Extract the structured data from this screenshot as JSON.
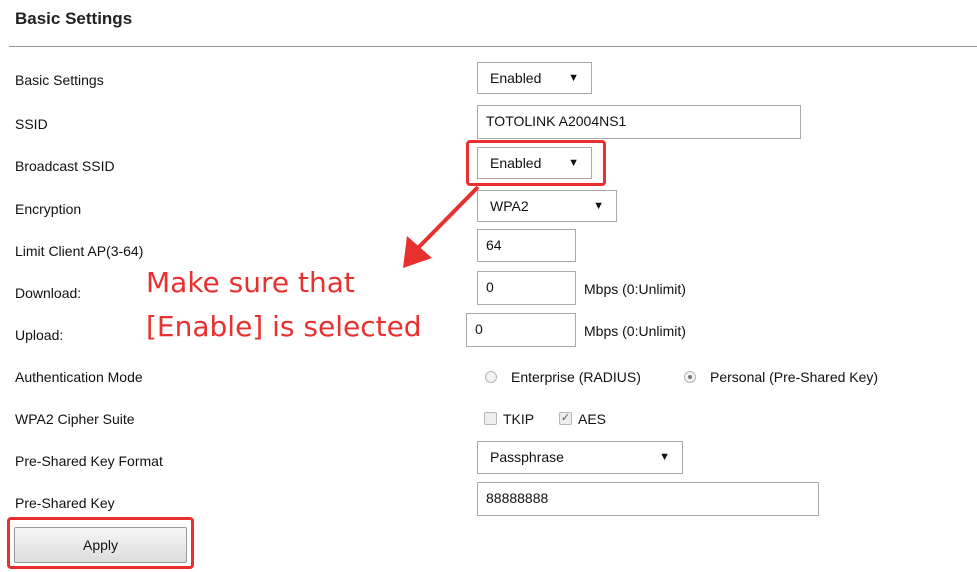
{
  "page": {
    "title": "Basic Settings"
  },
  "rows": {
    "basic_settings": {
      "label": "Basic Settings",
      "value": "Enabled"
    },
    "ssid": {
      "label": "SSID",
      "value": "TOTOLINK A2004NS1"
    },
    "broadcast_ssid": {
      "label": "Broadcast SSID",
      "value": "Enabled"
    },
    "encryption": {
      "label": "Encryption",
      "value": "WPA2"
    },
    "limit_client": {
      "label": "Limit Client AP(3-64)",
      "value": "64"
    },
    "download": {
      "label": "Download:",
      "value": "0",
      "unit": "Mbps (0:Unlimit)"
    },
    "upload": {
      "label": "Upload:",
      "value": "0",
      "unit": "Mbps (0:Unlimit)"
    },
    "auth_mode": {
      "label": "Authentication Mode",
      "options": [
        "Enterprise (RADIUS)",
        "Personal (Pre-Shared Key)"
      ],
      "selected": "Personal (Pre-Shared Key)"
    },
    "cipher_suite": {
      "label": "WPA2 Cipher Suite",
      "options": [
        {
          "label": "TKIP",
          "checked": false
        },
        {
          "label": "AES",
          "checked": true
        }
      ]
    },
    "psk_format": {
      "label": "Pre-Shared Key Format",
      "value": "Passphrase"
    },
    "psk": {
      "label": "Pre-Shared Key",
      "value": "88888888"
    }
  },
  "apply_button": {
    "label": "Apply"
  },
  "annotation": {
    "line1": "Make sure that",
    "line2": "[Enable] is selected",
    "color": "#e8312e"
  },
  "icons": {
    "dropdown_arrow": "▼",
    "check_mark": "✓"
  }
}
